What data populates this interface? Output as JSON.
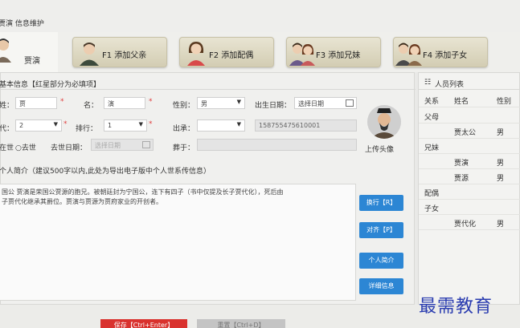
{
  "window": {
    "title": "贾演 信息维护"
  },
  "tabs": {
    "active_name": "贾演",
    "items": [
      {
        "label": "F1 添加父亲"
      },
      {
        "label": "F2 添加配偶"
      },
      {
        "label": "F3 添加兄妹"
      },
      {
        "label": "F4 添加子女"
      }
    ]
  },
  "basic": {
    "header": "基本信息【红星部分为必填项】",
    "surname_label": "姓：",
    "surname_value": "贾",
    "name_label": "名：",
    "name_value": "演",
    "gender_label": "性别：",
    "gender_value": "男",
    "birth_label": "出生日期：",
    "birth_placeholder": "选择日期",
    "gen_label": "代：",
    "gen_value": "2",
    "rank_label": "排行：",
    "rank_value": "1",
    "inherit_label": "出承：",
    "inherit_value": "",
    "phone_value": "158755475610001",
    "alive_label": "在世",
    "dead_label": "去世",
    "death_label": "去世日期：",
    "death_placeholder": "选择日期",
    "burial_label": "葬于：",
    "upload_label": "上传头像",
    "star": "*"
  },
  "bio": {
    "header": "个人简介（建议500字以内,此处为导出电子版中个人世系传信息）",
    "text_line1": "国公 贾演是荣国公贾源的胞兄。被朝廷封为宁国公，连下有四子（书中仅提及长子贾代化），死后由",
    "text_line2": "子贾代化继承其爵位。贾演与贾源为贾府家业的开创者。"
  },
  "side_buttons": {
    "wrap": "换行【R】",
    "align": "对齐【P】",
    "profile": "个人简介",
    "detail": "详细信息"
  },
  "person_list": {
    "title": "人员列表",
    "columns": [
      "关系",
      "姓名",
      "性别"
    ],
    "rows": [
      {
        "relation": "父母",
        "name": "",
        "gender": ""
      },
      {
        "relation": "",
        "name": "贾太公",
        "gender": "男"
      },
      {
        "relation": "兄妹",
        "name": "",
        "gender": ""
      },
      {
        "relation": "",
        "name": "贾演",
        "gender": "男"
      },
      {
        "relation": "",
        "name": "贾源",
        "gender": "男"
      },
      {
        "relation": "配偶",
        "name": "",
        "gender": ""
      },
      {
        "relation": "子女",
        "name": "",
        "gender": ""
      },
      {
        "relation": "",
        "name": "贾代化",
        "gender": "男"
      }
    ]
  },
  "footer": {
    "save_label": "保存【Ctrl+Enter】",
    "reset_label": "重置【Ctrl+D】"
  },
  "watermark": "最需教育"
}
